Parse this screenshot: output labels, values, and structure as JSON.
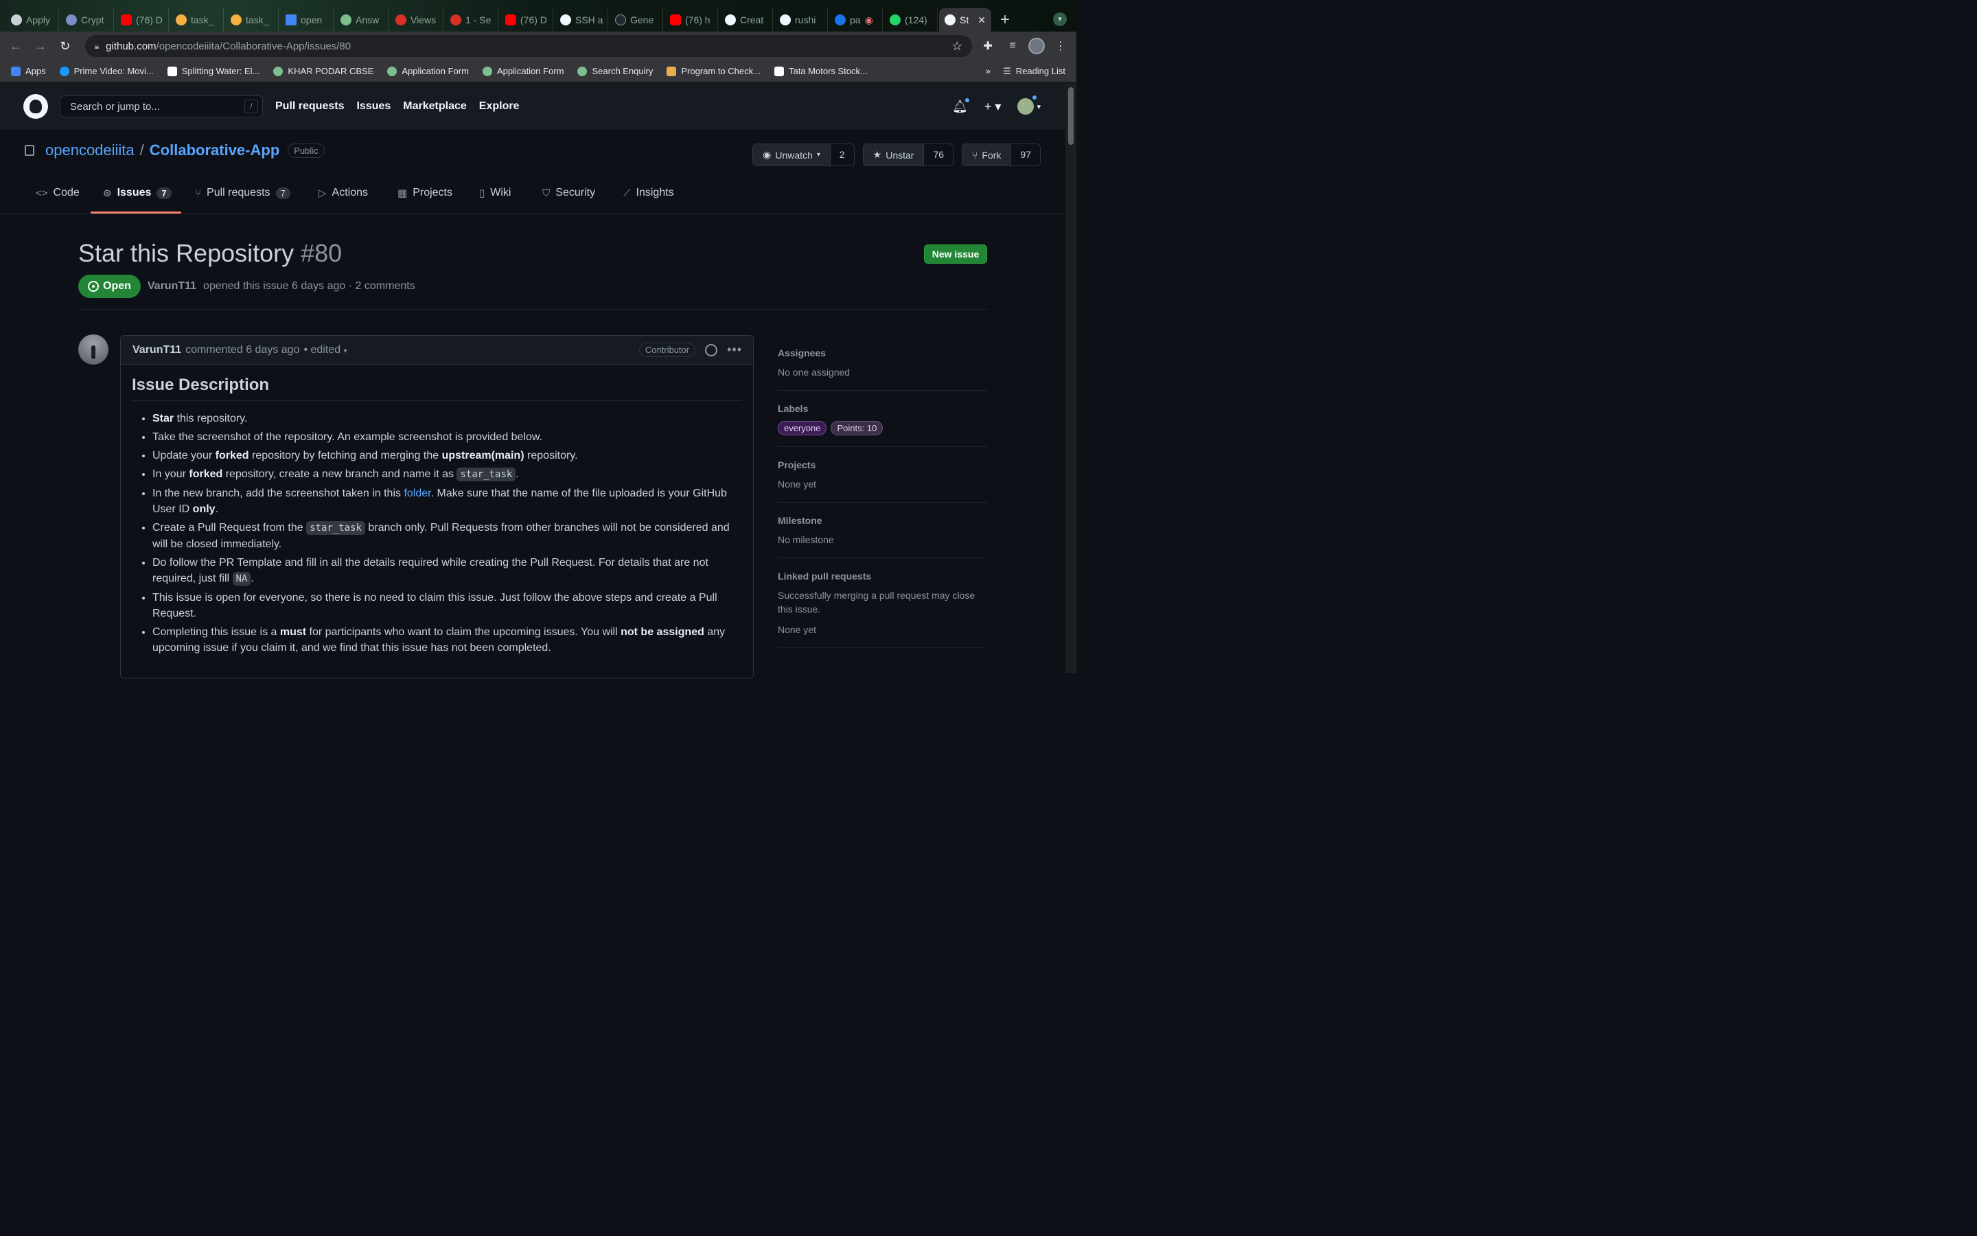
{
  "browser": {
    "tabs": [
      {
        "title": "Apply",
        "color": "#c9d1d9"
      },
      {
        "title": "Crypt",
        "color": "#7d8cc4"
      },
      {
        "title": "(76) D",
        "color": "#ff0000"
      },
      {
        "title": "task_",
        "color": "#f5b041"
      },
      {
        "title": "task_",
        "color": "#f5b041"
      },
      {
        "title": "open",
        "color": "#4285f4"
      },
      {
        "title": "Answ",
        "color": "#7cbf8f"
      },
      {
        "title": "Views",
        "color": "#d93025"
      },
      {
        "title": "1 - Se",
        "color": "#d93025"
      },
      {
        "title": "(76) D",
        "color": "#ff0000"
      },
      {
        "title": "SSH a",
        "color": "#f0f6fc"
      },
      {
        "title": "Gene",
        "color": "#24292f"
      },
      {
        "title": "(76) h",
        "color": "#ff0000"
      },
      {
        "title": "Creat",
        "color": "#f0f6fc"
      },
      {
        "title": "rushi",
        "color": "#f0f6fc"
      },
      {
        "title": "pa",
        "color": "#1a73e8"
      },
      {
        "title": "(124)",
        "color": "#25d366"
      },
      {
        "title": "St",
        "color": "#f0f6fc"
      }
    ],
    "url_host": "github.com",
    "url_path": "/opencodeiiita/Collaborative-App/issues/80",
    "bookmarks": [
      {
        "label": "Apps",
        "color": "#4285f4"
      },
      {
        "label": "Prime Video: Movi...",
        "color": "#1a98ff"
      },
      {
        "label": "Splitting Water: El...",
        "color": "#ffffff"
      },
      {
        "label": "KHAR PODAR CBSE",
        "color": "#7cbf8f"
      },
      {
        "label": "Application Form",
        "color": "#7cbf8f"
      },
      {
        "label": "Application Form",
        "color": "#7cbf8f"
      },
      {
        "label": "Search Enquiry",
        "color": "#7cbf8f"
      },
      {
        "label": "Program to Check...",
        "color": "#e8b04a"
      },
      {
        "label": "Tata Motors Stock...",
        "color": "#ffffff"
      }
    ],
    "bookmarks_overflow": "»",
    "reading_list": "Reading List"
  },
  "github": {
    "search_placeholder": "Search or jump to...",
    "search_shortcut": "/",
    "nav": [
      "Pull requests",
      "Issues",
      "Marketplace",
      "Explore"
    ]
  },
  "repo": {
    "owner": "opencodeiiita",
    "separator": "/",
    "name": "Collaborative-App",
    "visibility": "Public",
    "watch_label": "Unwatch",
    "watch_count": "2",
    "star_label": "Unstar",
    "star_count": "76",
    "fork_label": "Fork",
    "fork_count": "97",
    "tabs": [
      {
        "label": "Code",
        "icon": "<>",
        "count": ""
      },
      {
        "label": "Issues",
        "icon": "⊙",
        "count": "7"
      },
      {
        "label": "Pull requests",
        "icon": "⑂",
        "count": "7"
      },
      {
        "label": "Actions",
        "icon": "▷",
        "count": ""
      },
      {
        "label": "Projects",
        "icon": "▦",
        "count": ""
      },
      {
        "label": "Wiki",
        "icon": "▯",
        "count": ""
      },
      {
        "label": "Security",
        "icon": "⛉",
        "count": ""
      },
      {
        "label": "Insights",
        "icon": "⟋",
        "count": ""
      }
    ]
  },
  "issue": {
    "title": "Star this Repository",
    "number": "#80",
    "new_issue_label": "New issue",
    "state": "Open",
    "author": "VarunT11",
    "meta": "opened this issue 6 days ago · 2 comments"
  },
  "comment": {
    "author": "VarunT11",
    "time": "commented 6 days ago",
    "edited": "• edited",
    "role": "Contributor",
    "heading": "Issue Description"
  },
  "sidebar": {
    "assignees_h": "Assignees",
    "assignees_v": "No one assigned",
    "labels_h": "Labels",
    "label_everyone": "everyone",
    "label_points": "Points: 10",
    "projects_h": "Projects",
    "projects_v": "None yet",
    "milestone_h": "Milestone",
    "milestone_v": "No milestone",
    "linked_h": "Linked pull requests",
    "linked_desc": "Successfully merging a pull request may close this issue.",
    "linked_v": "None yet"
  },
  "colors": {
    "accent_blue": "#58a6ff",
    "open_green": "#238636",
    "tab_underline": "#f78166"
  }
}
